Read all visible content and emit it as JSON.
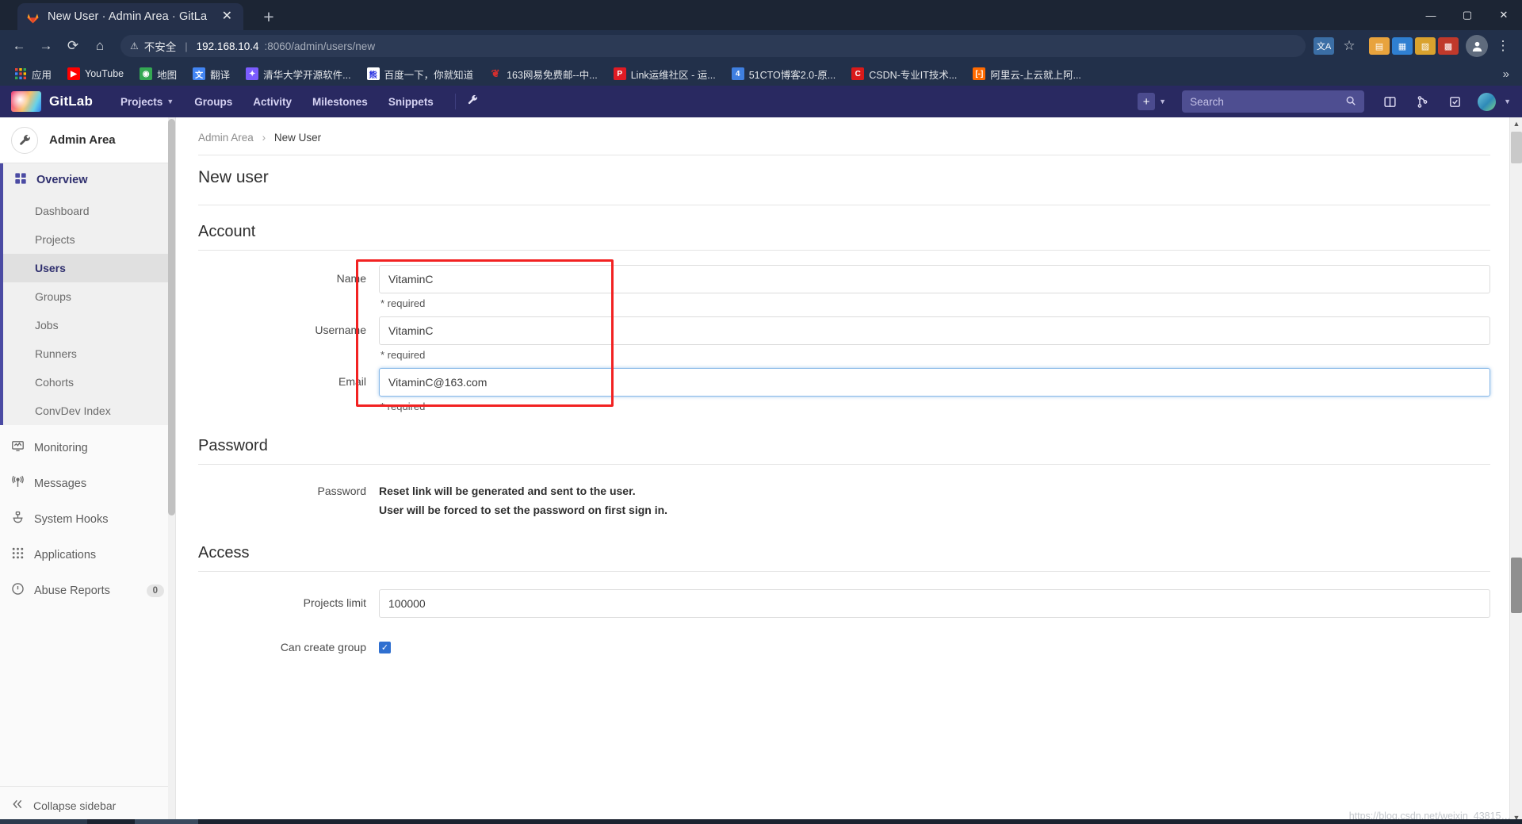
{
  "browser": {
    "tab": {
      "title": "New User · Admin Area · GitLa",
      "favicon": "gitlab-fox-icon",
      "close": "✕"
    },
    "new_tab": "+",
    "window_controls": {
      "minimize": "—",
      "maximize": "▢",
      "close": "✕"
    },
    "toolbar": {
      "back": "←",
      "forward": "→",
      "reload": "⟳",
      "home": "⌂",
      "security_warning_icon": "⚠",
      "security_label": "不安全",
      "url_host": "192.168.10.4",
      "url_path": ":8060/admin/users/new",
      "star": "☆",
      "profile": "person-icon",
      "menu": "⋮"
    },
    "bookmarks": [
      {
        "label": "应用",
        "icon": "apps-grid-icon",
        "color": "#4285f4"
      },
      {
        "label": "YouTube",
        "icon": "youtube-icon",
        "color": "#ff0000"
      },
      {
        "label": "地图",
        "icon": "maps-icon",
        "color": "#34a853"
      },
      {
        "label": "翻译",
        "icon": "translate-icon",
        "color": "#4285f4"
      },
      {
        "label": "清华大学开源软件...",
        "icon": "tsinghua-icon",
        "color": "#7b5cff"
      },
      {
        "label": "百度一下，你就知道",
        "icon": "baidu-icon",
        "color": "#2932e1"
      },
      {
        "label": "163网易免费邮--中...",
        "icon": "netease-icon",
        "color": "#d32f2f"
      },
      {
        "label": "Link运维社区 - 运...",
        "icon": "link-icon",
        "color": "#e01b24"
      },
      {
        "label": "51CTO博客2.0-原...",
        "icon": "cto51-icon",
        "color": "#3f7fe0"
      },
      {
        "label": "CSDN-专业IT技术...",
        "icon": "csdn-icon",
        "color": "#d91a1a"
      },
      {
        "label": "阿里云-上云就上阿...",
        "icon": "aliyun-icon",
        "color": "#ff6a00"
      }
    ],
    "bookmark_overflow": "»"
  },
  "gitlab": {
    "brand": "GitLab",
    "nav": [
      {
        "label": "Projects",
        "has_caret": true
      },
      {
        "label": "Groups",
        "has_caret": false
      },
      {
        "label": "Activity",
        "has_caret": false
      },
      {
        "label": "Milestones",
        "has_caret": false
      },
      {
        "label": "Snippets",
        "has_caret": false
      }
    ],
    "admin_wrench_icon": "🔧",
    "new_button": "+",
    "search": {
      "placeholder": "Search",
      "value": ""
    },
    "right_icons": [
      "issues-icon",
      "merge-requests-icon",
      "todos-icon"
    ],
    "user_avatar": "user-avatar"
  },
  "sidebar": {
    "header": {
      "title": "Admin Area",
      "icon": "wrench-icon"
    },
    "overview": {
      "label": "Overview",
      "icon": "overview-grid-icon"
    },
    "sub_items": [
      {
        "label": "Dashboard",
        "active": false
      },
      {
        "label": "Projects",
        "active": false
      },
      {
        "label": "Users",
        "active": true
      },
      {
        "label": "Groups",
        "active": false
      },
      {
        "label": "Jobs",
        "active": false
      },
      {
        "label": "Runners",
        "active": false
      },
      {
        "label": "Cohorts",
        "active": false
      },
      {
        "label": "ConvDev Index",
        "active": false
      }
    ],
    "items": [
      {
        "label": "Monitoring",
        "icon": "monitor-icon",
        "badge": null
      },
      {
        "label": "Messages",
        "icon": "broadcast-icon",
        "badge": null
      },
      {
        "label": "System Hooks",
        "icon": "hook-icon",
        "badge": null
      },
      {
        "label": "Applications",
        "icon": "applications-icon",
        "badge": null
      },
      {
        "label": "Abuse Reports",
        "icon": "abuse-icon",
        "badge": "0"
      }
    ],
    "collapse": {
      "label": "Collapse sidebar",
      "icon": "double-chevron-left-icon"
    }
  },
  "main": {
    "breadcrumb": {
      "root": "Admin Area",
      "separator": "›",
      "current": "New User"
    },
    "page_title": "New user",
    "sections": {
      "account": {
        "title": "Account",
        "fields": [
          {
            "label": "Name",
            "value": "VitaminC",
            "hint": "* required",
            "focused": false
          },
          {
            "label": "Username",
            "value": "VitaminC",
            "hint": "* required",
            "focused": false
          },
          {
            "label": "Email",
            "value": "VitaminC@163.com",
            "hint": "* required",
            "focused": true
          }
        ]
      },
      "password": {
        "title": "Password",
        "label": "Password",
        "note_line1": "Reset link will be generated and sent to the user.",
        "note_line2": "User will be forced to set the password on first sign in."
      },
      "access": {
        "title": "Access",
        "projects_limit_label": "Projects limit",
        "projects_limit_value": "100000",
        "can_create_group_label": "Can create group",
        "can_create_group_checked": true,
        "checkmark": "✓"
      }
    }
  },
  "annotation": {
    "color": "#f22222",
    "note": "red-highlight-box-around-account-fields"
  },
  "watermark": "https://blog.csdn.net/weixin_43815…"
}
